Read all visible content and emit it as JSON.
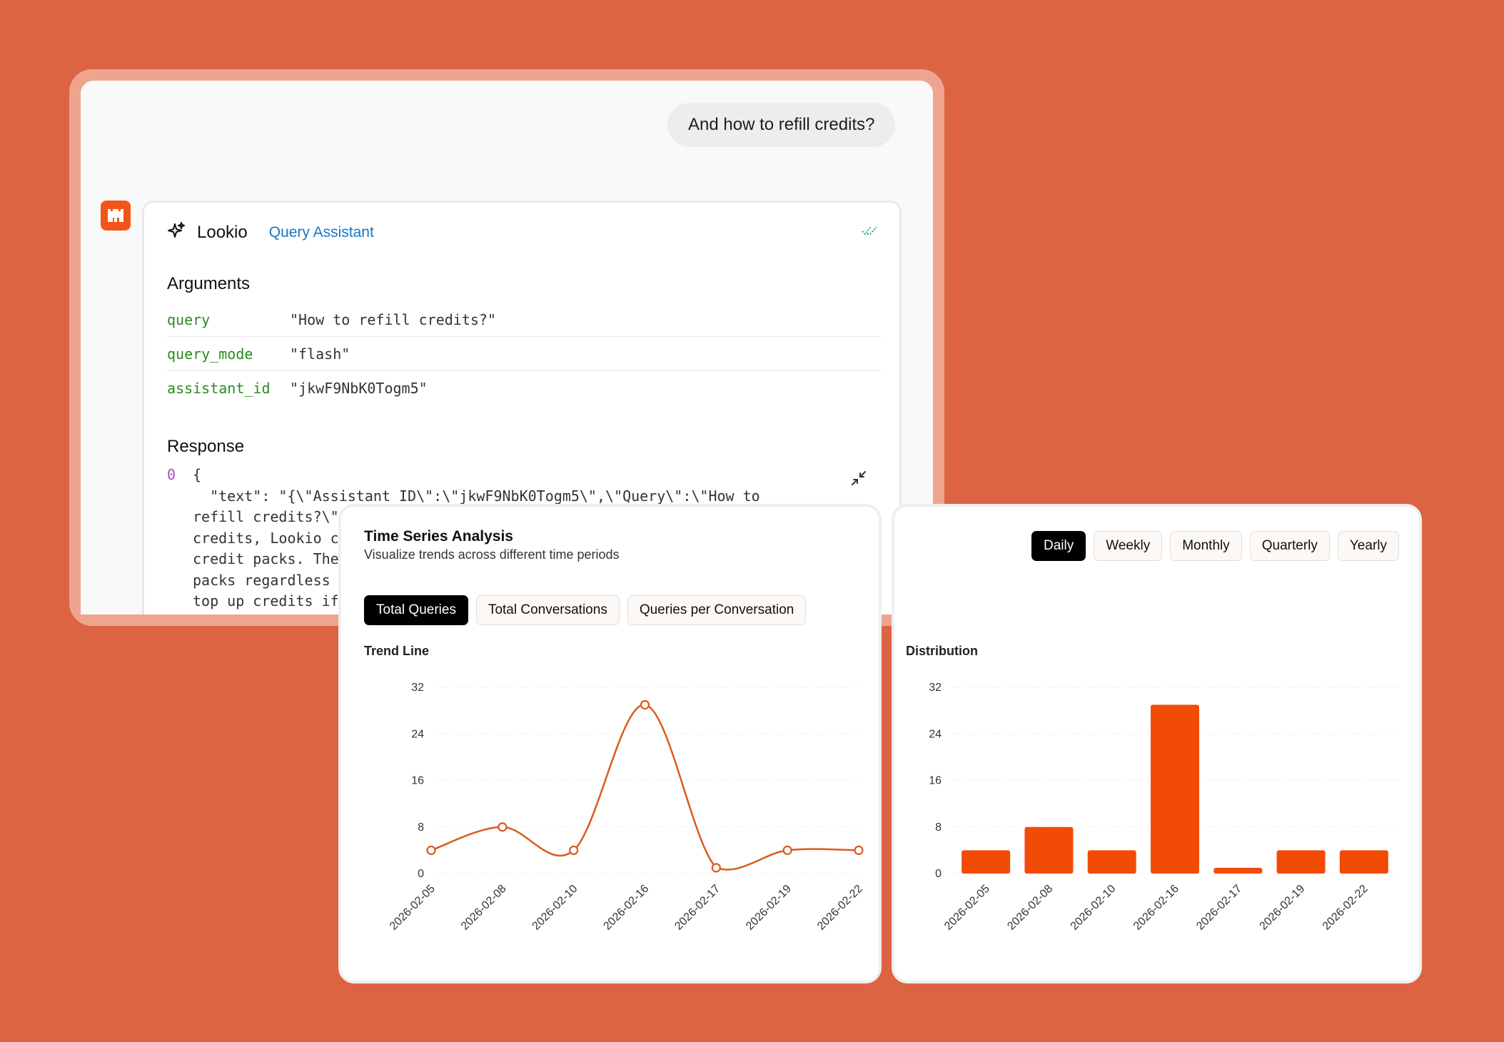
{
  "chat": {
    "user_message": "And how to refill credits?",
    "tool": {
      "name": "Lookio",
      "tag": "Query Assistant",
      "arguments_title": "Arguments",
      "arguments": [
        {
          "key": "query",
          "value": "\"How to refill credits?\""
        },
        {
          "key": "query_mode",
          "value": "\"flash\""
        },
        {
          "key": "assistant_id",
          "value": "\"jkwF9NbK0Togm5\""
        }
      ],
      "response_title": "Response",
      "response_index": "0",
      "response_text": "{\n  \"text\": \"{\\\"Assistant ID\\\":\\\"jkwF9NbK0Togm5\\\",\\\"Query\\\":\\\"How to\nrefill credits?\\\"\ncredits, Lookio c\ncredit packs. The\npacks regardless\ntop up credits if"
    }
  },
  "time_series": {
    "title": "Time Series Analysis",
    "subtitle": "Visualize trends across different time periods",
    "metric_tabs": [
      "Total Queries",
      "Total Conversations",
      "Queries per Conversation"
    ],
    "active_metric": 0,
    "trend_label": "Trend Line"
  },
  "distribution": {
    "period_tabs": [
      "Daily",
      "Weekly",
      "Monthly",
      "Quarterly",
      "Yearly"
    ],
    "active_period": 0,
    "label": "Distribution"
  },
  "colors": {
    "line": "#DC5A1E",
    "bar": "#F24B06"
  },
  "chart_data": [
    {
      "type": "line",
      "title": "Trend Line",
      "x": [
        "2026-02-05",
        "2026-02-08",
        "2026-02-10",
        "2026-02-16",
        "2026-02-17",
        "2026-02-19",
        "2026-02-22"
      ],
      "values": [
        4,
        8,
        4,
        29,
        1,
        4,
        4
      ],
      "yticks": [
        0,
        8,
        16,
        24,
        32
      ],
      "ylim": [
        0,
        32
      ],
      "grid": true
    },
    {
      "type": "bar",
      "title": "Distribution",
      "categories": [
        "2026-02-05",
        "2026-02-08",
        "2026-02-10",
        "2026-02-16",
        "2026-02-17",
        "2026-02-19",
        "2026-02-22"
      ],
      "values": [
        4,
        8,
        4,
        29,
        1,
        4,
        4
      ],
      "yticks": [
        0,
        8,
        16,
        24,
        32
      ],
      "ylim": [
        0,
        32
      ],
      "grid": true
    }
  ]
}
